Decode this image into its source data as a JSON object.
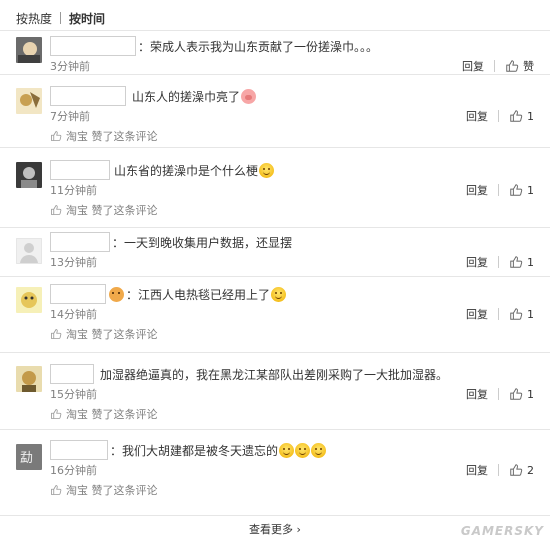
{
  "sort": {
    "hot": "按热度",
    "time": "按时间"
  },
  "comments": [
    {
      "text": "：荣成人表示我为山东贡献了一份搓澡巾。。。",
      "time": "3分钟前",
      "reply": "回复",
      "like": "赞",
      "liked_by": ""
    },
    {
      "text": "山东人的搓澡巾亮了",
      "time": "7分钟前",
      "reply": "回复",
      "like": "1",
      "liked_by": "淘宝 赞了这条评论"
    },
    {
      "text": "山东省的搓澡巾是个什么梗",
      "time": "11分钟前",
      "reply": "回复",
      "like": "1",
      "liked_by": "淘宝 赞了这条评论"
    },
    {
      "text": "：一天到晚收集用户数据，还显摆",
      "time": "13分钟前",
      "reply": "回复",
      "like": "1",
      "liked_by": ""
    },
    {
      "text": "：江西人电热毯已经用上了",
      "time": "14分钟前",
      "reply": "回复",
      "like": "1",
      "liked_by": "淘宝 赞了这条评论"
    },
    {
      "text": "加湿器绝逼真的，我在黑龙江某部队出差刚采购了一大批加湿器。",
      "time": "15分钟前",
      "reply": "回复",
      "like": "1",
      "liked_by": "淘宝 赞了这条评论"
    },
    {
      "text": "：我们大胡建都是被冬天遗忘的",
      "time": "16分钟前",
      "reply": "回复",
      "like": "2",
      "liked_by": "淘宝 赞了这条评论"
    }
  ],
  "footer": {
    "more": "查看更多 ›"
  },
  "watermark": "GAMERSKY"
}
